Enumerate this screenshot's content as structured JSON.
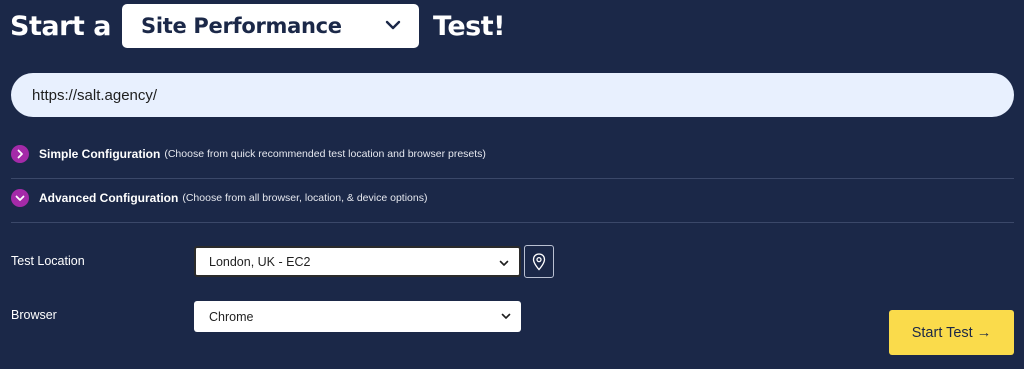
{
  "heading": {
    "prefix": "Start a",
    "test_type": "Site Performance",
    "suffix": "Test!"
  },
  "url_input": {
    "value": "https://salt.agency/"
  },
  "simple_config": {
    "title": "Simple Configuration",
    "description": "(Choose from quick recommended test location and browser presets)",
    "icon": "chevron-right-icon"
  },
  "advanced_config": {
    "title": "Advanced Configuration",
    "description": "(Choose from all browser, location, & device options)",
    "icon": "chevron-down-icon"
  },
  "test_location": {
    "label": "Test Location",
    "selected": "London, UK - EC2",
    "map_icon": "map-pin-icon"
  },
  "browser": {
    "label": "Browser",
    "selected": "Chrome"
  },
  "start_button": {
    "label": "Start Test →"
  },
  "colors": {
    "background": "#1b2848",
    "accent_purple": "#a42aa8",
    "start_button": "#fadb4b",
    "url_field": "#e8f0fe"
  }
}
